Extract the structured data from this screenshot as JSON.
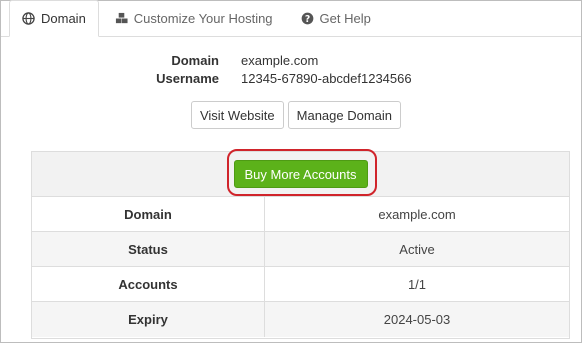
{
  "tabs": [
    {
      "label": "Domain",
      "icon": "globe-icon",
      "active": true
    },
    {
      "label": "Customize Your Hosting",
      "icon": "cubes-icon",
      "active": false
    },
    {
      "label": "Get Help",
      "icon": "question-circle-icon",
      "active": false
    }
  ],
  "info": {
    "domain_label": "Domain",
    "domain_value": "example.com",
    "username_label": "Username",
    "username_value": "12345-67890-abcdef1234566"
  },
  "actions": {
    "visit_website": "Visit Website",
    "manage_domain": "Manage Domain"
  },
  "panel": {
    "buy_more_label": "Buy More Accounts",
    "rows": [
      {
        "label": "Domain",
        "value": "example.com"
      },
      {
        "label": "Status",
        "value": "Active"
      },
      {
        "label": "Accounts",
        "value": "1/1"
      },
      {
        "label": "Expiry",
        "value": "2024-05-03"
      }
    ]
  },
  "colors": {
    "accent_green": "#5cb21a",
    "highlight_red": "#d0242b"
  }
}
